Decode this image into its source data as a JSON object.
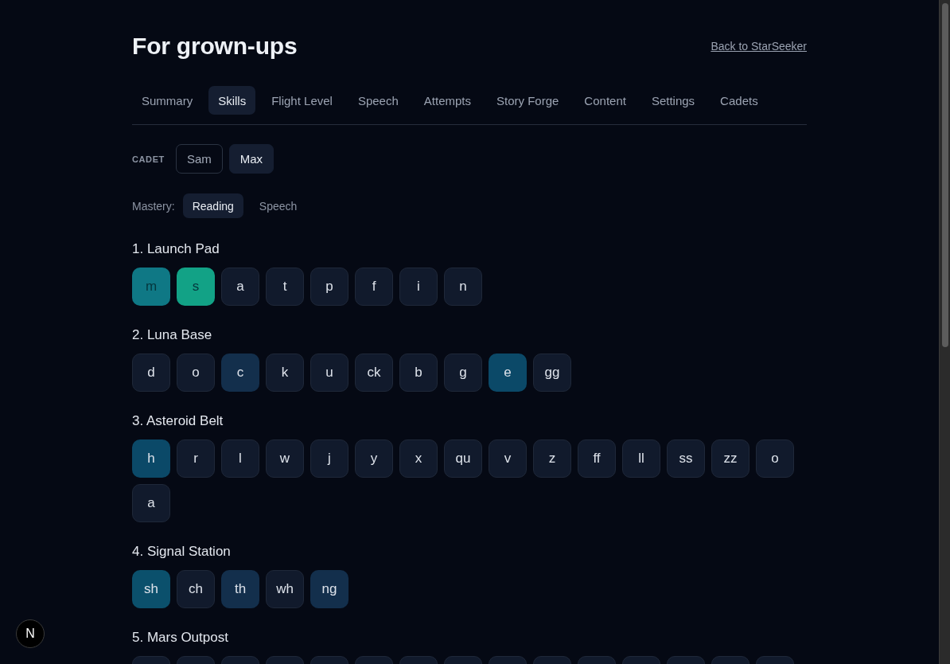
{
  "page": {
    "title": "For grown-ups",
    "back_link": "Back to StarSeeker"
  },
  "tabs": [
    {
      "label": "Summary",
      "selected": false
    },
    {
      "label": "Skills",
      "selected": true
    },
    {
      "label": "Flight Level",
      "selected": false
    },
    {
      "label": "Speech",
      "selected": false
    },
    {
      "label": "Attempts",
      "selected": false
    },
    {
      "label": "Story Forge",
      "selected": false
    },
    {
      "label": "Content",
      "selected": false
    },
    {
      "label": "Settings",
      "selected": false
    },
    {
      "label": "Cadets",
      "selected": false
    }
  ],
  "cadet_picker": {
    "label": "CADET",
    "options": [
      {
        "label": "Sam",
        "selected": false
      },
      {
        "label": "Max",
        "selected": true
      }
    ]
  },
  "mastery_picker": {
    "label": "Mastery:",
    "options": [
      {
        "label": "Reading",
        "selected": true
      },
      {
        "label": "Speech",
        "selected": false
      }
    ]
  },
  "sections": [
    {
      "title": "1. Launch Pad",
      "tiles": [
        {
          "label": "m",
          "color": "#0f7885"
        },
        {
          "label": "s",
          "color": "#12a286"
        },
        {
          "label": "a",
          "color": "#111a2c"
        },
        {
          "label": "t",
          "color": "#111a2c"
        },
        {
          "label": "p",
          "color": "#111a2c"
        },
        {
          "label": "f",
          "color": "#111a2c"
        },
        {
          "label": "i",
          "color": "#111a2c"
        },
        {
          "label": "n",
          "color": "#111a2c"
        }
      ]
    },
    {
      "title": "2. Luna Base",
      "tiles": [
        {
          "label": "d",
          "color": "#111a2c"
        },
        {
          "label": "o",
          "color": "#111a2c"
        },
        {
          "label": "c",
          "color": "#132f4c"
        },
        {
          "label": "k",
          "color": "#111a2c"
        },
        {
          "label": "u",
          "color": "#111a2c"
        },
        {
          "label": "ck",
          "color": "#111a2c"
        },
        {
          "label": "b",
          "color": "#111a2c"
        },
        {
          "label": "g",
          "color": "#111a2c"
        },
        {
          "label": "e",
          "color": "#0b4968"
        },
        {
          "label": "gg",
          "color": "#111a2c"
        }
      ]
    },
    {
      "title": "3. Asteroid Belt",
      "tiles": [
        {
          "label": "h",
          "color": "#0b4968"
        },
        {
          "label": "r",
          "color": "#111a2c"
        },
        {
          "label": "l",
          "color": "#111a2c"
        },
        {
          "label": "w",
          "color": "#111a2c"
        },
        {
          "label": "j",
          "color": "#111a2c"
        },
        {
          "label": "y",
          "color": "#111a2c"
        },
        {
          "label": "x",
          "color": "#111a2c"
        },
        {
          "label": "qu",
          "color": "#111a2c"
        },
        {
          "label": "v",
          "color": "#111a2c"
        },
        {
          "label": "z",
          "color": "#111a2c"
        },
        {
          "label": "ff",
          "color": "#111a2c"
        },
        {
          "label": "ll",
          "color": "#111a2c"
        },
        {
          "label": "ss",
          "color": "#111a2c"
        },
        {
          "label": "zz",
          "color": "#111a2c"
        },
        {
          "label": "o",
          "color": "#111a2c"
        },
        {
          "label": "a",
          "color": "#111a2c"
        }
      ]
    },
    {
      "title": "4. Signal Station",
      "tiles": [
        {
          "label": "sh",
          "color": "#0b506c"
        },
        {
          "label": "ch",
          "color": "#111a2c"
        },
        {
          "label": "th",
          "color": "#132f4c"
        },
        {
          "label": "wh",
          "color": "#111a2c"
        },
        {
          "label": "ng",
          "color": "#132f4c"
        }
      ]
    },
    {
      "title": "5. Mars Outpost",
      "tiles": [
        {
          "color": "#111a2c"
        },
        {
          "color": "#111a2c"
        },
        {
          "color": "#111a2c"
        },
        {
          "color": "#111a2c"
        },
        {
          "color": "#111a2c"
        },
        {
          "color": "#111a2c"
        },
        {
          "color": "#111a2c"
        },
        {
          "color": "#111a2c"
        },
        {
          "color": "#111a2c"
        },
        {
          "color": "#111a2c"
        },
        {
          "color": "#111a2c"
        },
        {
          "color": "#111a2c"
        },
        {
          "color": "#111a2c"
        },
        {
          "color": "#111a2c"
        },
        {
          "color": "#111a2c"
        }
      ]
    }
  ],
  "dev_badge": {
    "label": "N"
  }
}
